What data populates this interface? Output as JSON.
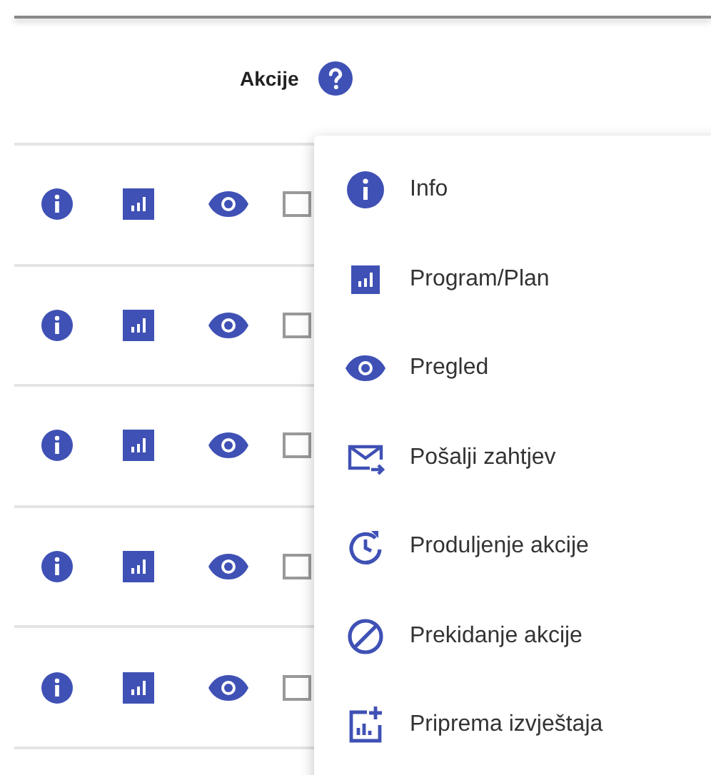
{
  "table": {
    "columns": [
      {
        "label": "Akcije"
      }
    ]
  },
  "menu": {
    "items": [
      {
        "label": "Info"
      },
      {
        "label": "Program/Plan"
      },
      {
        "label": "Pregled"
      },
      {
        "label": "Pošalji zahtjev"
      },
      {
        "label": "Produljenje akcije"
      },
      {
        "label": "Prekidanje akcije"
      },
      {
        "label": "Priprema izvještaja"
      }
    ]
  }
}
